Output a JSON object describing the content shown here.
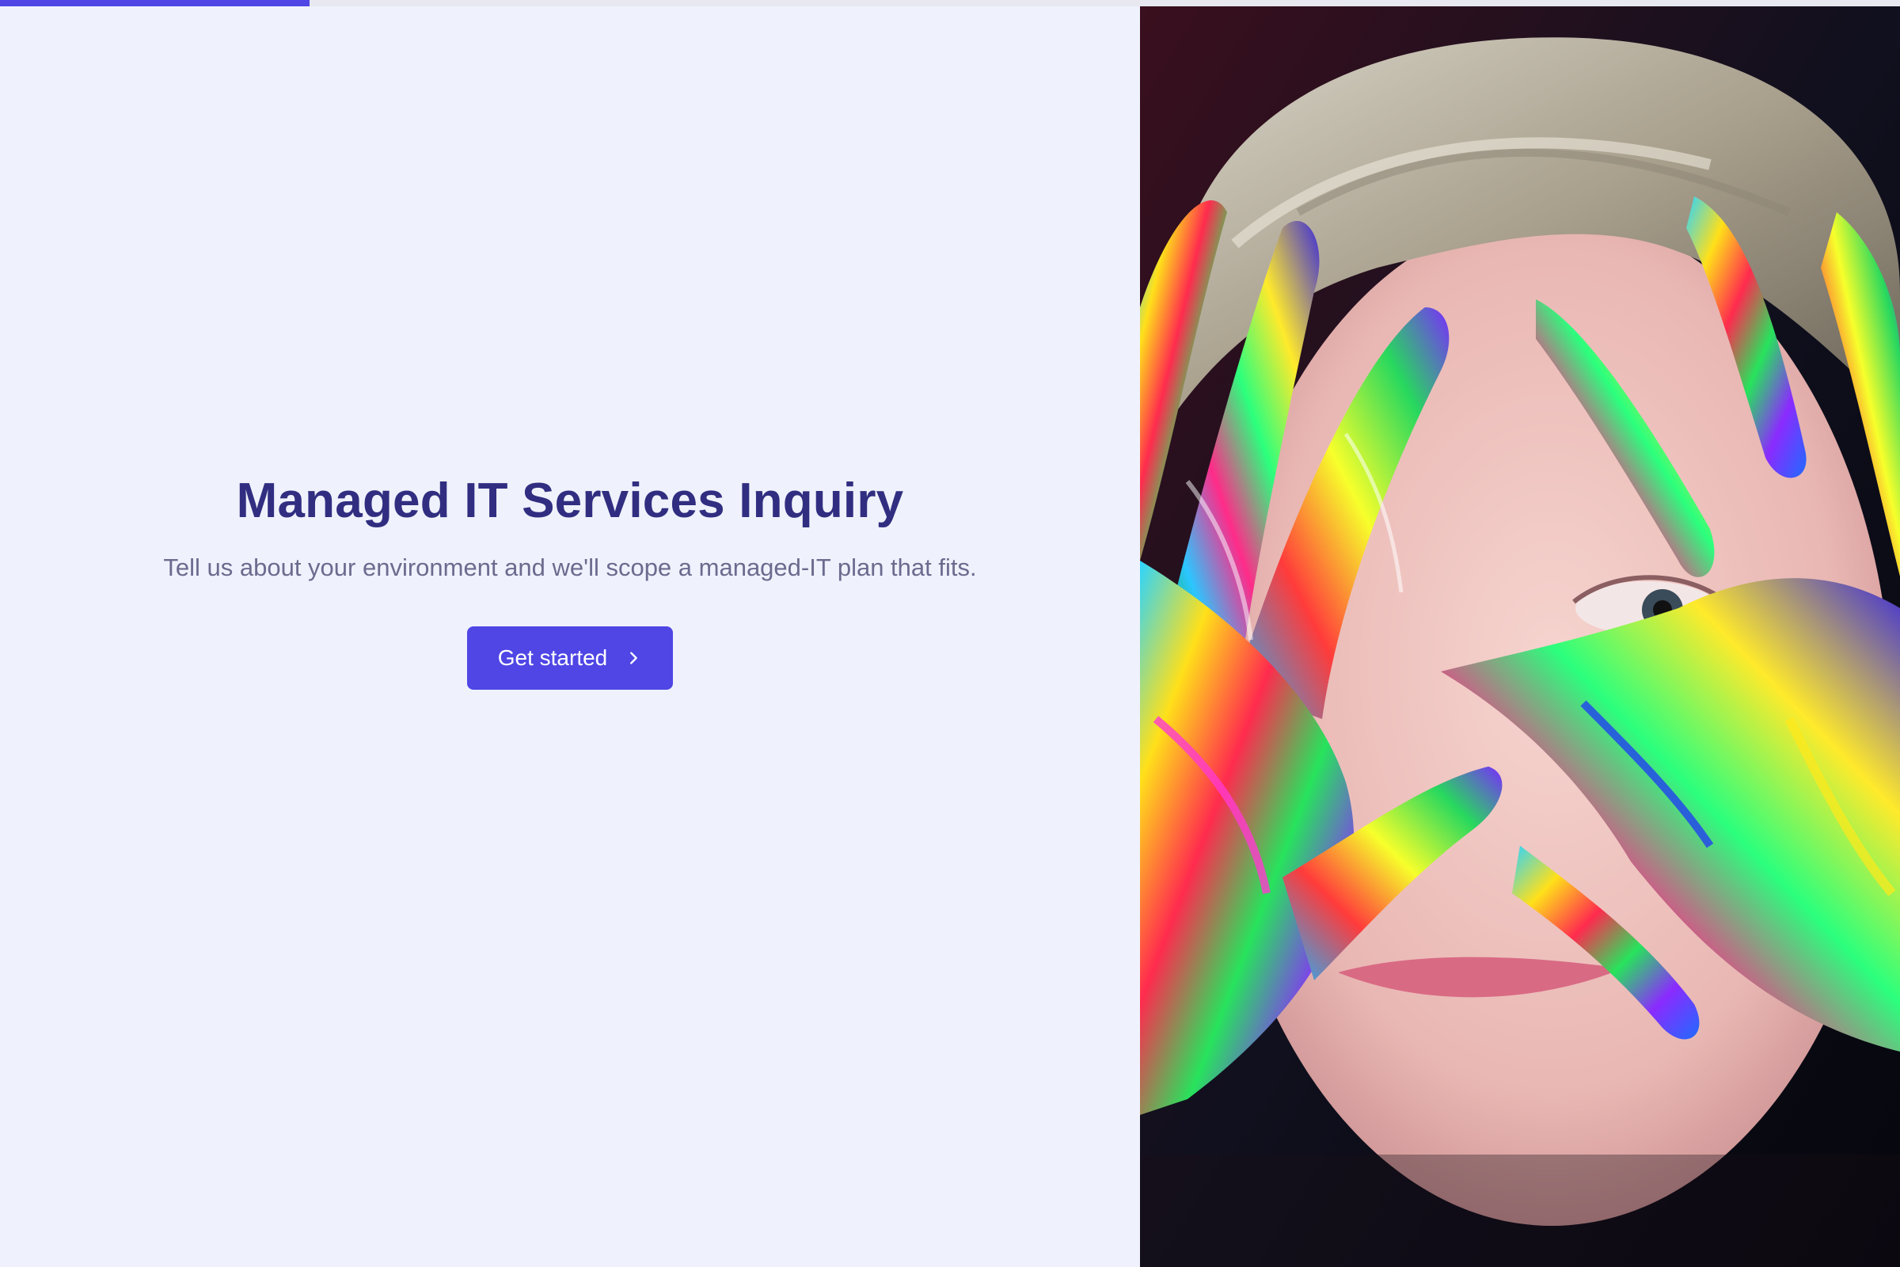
{
  "progress": {
    "fraction": 0.163,
    "color": "#4f46e5"
  },
  "hero": {
    "title": "Managed IT Services Inquiry",
    "subtitle": "Tell us about your environment and we'll scope a managed-IT plan that fits.",
    "cta_label": "Get started",
    "cta_icon": "chevron-right-icon"
  },
  "colors": {
    "background": "#eff2fc",
    "accent": "#4f46e5",
    "title": "#312e81",
    "subtitle": "#6b6b8f"
  },
  "image": {
    "subject": "child-with-rainbow-painted-hands"
  }
}
